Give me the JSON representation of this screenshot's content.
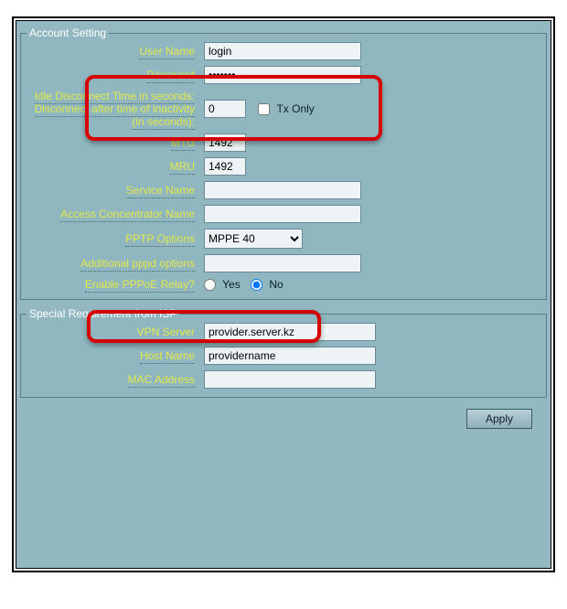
{
  "account": {
    "legend": "Account Setting",
    "user_name_label": "User Name",
    "user_name_value": "login",
    "password_label": "Password",
    "password_value": "•••••••",
    "idle_label": "Idle Disconnect Time in seconds: Disconnect after time of inactivity (in seconds):",
    "idle_value": "0",
    "tx_only_label": "Tx Only",
    "mtu_label": "MTU",
    "mtu_value": "1492",
    "mru_label": "MRU",
    "mru_value": "1492",
    "service_name_label": "Service Name",
    "service_name_value": "",
    "ac_label": "Access Concentrator Name",
    "ac_value": "",
    "pptp_label": "PPTP Options",
    "pptp_value": "MPPE 40",
    "pppd_label": "Additional pppd options",
    "pppd_value": "",
    "relay_label": "Enable PPPoE Relay?",
    "relay_yes": "Yes",
    "relay_no": "No"
  },
  "isp": {
    "legend": "Special Requirement from ISP",
    "vpn_label": "VPN Server",
    "vpn_value": "provider.server.kz",
    "host_label": "Host Name",
    "host_value": "providername",
    "mac_label": "MAC Address",
    "mac_value": ""
  },
  "buttons": {
    "apply": "Apply"
  }
}
